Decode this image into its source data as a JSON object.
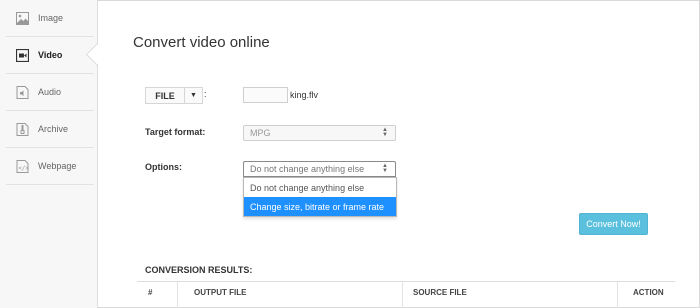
{
  "sidebar": {
    "items": [
      {
        "label": "Image",
        "icon": "image-icon",
        "active": false
      },
      {
        "label": "Video",
        "icon": "video-icon",
        "active": true
      },
      {
        "label": "Audio",
        "icon": "audio-icon",
        "active": false
      },
      {
        "label": "Archive",
        "icon": "archive-icon",
        "active": false
      },
      {
        "label": "Webpage",
        "icon": "webpage-icon",
        "active": false
      }
    ]
  },
  "main": {
    "title": "Convert video online",
    "file": {
      "button_label": "FILE",
      "colon": ":",
      "filename": "king.flv"
    },
    "target_format": {
      "label": "Target format:",
      "value": "MPG"
    },
    "options": {
      "label": "Options:",
      "value": "Do not change anything else",
      "dropdown_options": [
        "Do not change anything else",
        "Change size, bitrate or frame rate"
      ],
      "highlighted_index": 1
    },
    "convert_button": "Convert Now!",
    "results": {
      "title": "CONVERSION RESULTS:",
      "columns": [
        "#",
        "OUTPUT FILE",
        "SOURCE FILE",
        "ACTION"
      ]
    }
  },
  "colors": {
    "accent": "#5bc0de",
    "highlight": "#1e90ff",
    "sidebar_bg": "#f7f7f7"
  }
}
